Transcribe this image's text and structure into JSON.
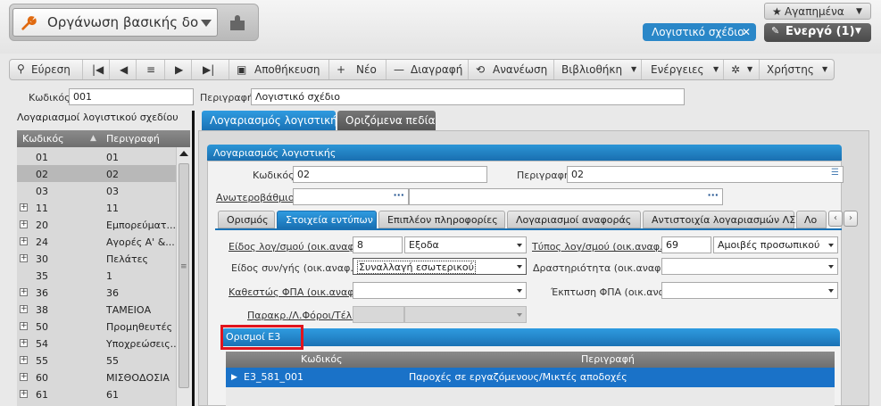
{
  "top": {
    "module_label": "Οργάνωση βασικής δομής",
    "favorites_label": "Αγαπημένα",
    "open_tag_label": "Λογιστικό σχέδιο",
    "active_label": "Ενεργό (1)"
  },
  "toolbar": {
    "search": "Εύρεση",
    "save": "Αποθήκευση",
    "new": "Νέο",
    "delete": "Διαγραφή",
    "refresh": "Ανανέωση",
    "library": "Βιβλιοθήκη",
    "actions": "Ενέργειες",
    "users": "Χρήστης"
  },
  "header": {
    "code_label": "Κωδικός",
    "code_value": "001",
    "desc_label": "Περιγραφή",
    "desc_value": "Λογιστικό σχέδιο"
  },
  "left_list": {
    "title": "Λογαριασμοί λογιστικού σχεδίου",
    "col_code": "Κωδικός",
    "col_desc": "Περιγραφή",
    "rows": [
      {
        "code": "01",
        "desc": "01",
        "expandable": false
      },
      {
        "code": "02",
        "desc": "02",
        "expandable": false
      },
      {
        "code": "03",
        "desc": "03",
        "expandable": false
      },
      {
        "code": "11",
        "desc": "11",
        "expandable": true
      },
      {
        "code": "20",
        "desc": "Εμπορεύματ...",
        "expandable": true
      },
      {
        "code": "24",
        "desc": "Αγορές Α' &...",
        "expandable": true
      },
      {
        "code": "30",
        "desc": "Πελάτες",
        "expandable": true
      },
      {
        "code": "35",
        "desc": "1",
        "expandable": false
      },
      {
        "code": "36",
        "desc": "36",
        "expandable": true
      },
      {
        "code": "38",
        "desc": "ΤΑΜΕΙΟΑ",
        "expandable": true
      },
      {
        "code": "50",
        "desc": "Προμηθευτές",
        "expandable": true
      },
      {
        "code": "54",
        "desc": "Υποχρεώσεις...",
        "expandable": true
      },
      {
        "code": "55",
        "desc": "55",
        "expandable": true
      },
      {
        "code": "60",
        "desc": "ΜΙΣΘΟΔΟΣΙΑ",
        "expandable": true
      },
      {
        "code": "61",
        "desc": "61",
        "expandable": true
      }
    ]
  },
  "main_tabs": [
    "Λογαριασμός λογιστικής",
    "Οριζόμενα πεδία"
  ],
  "account": {
    "section_title": "Λογαριασμός λογιστικής",
    "code_label": "Κωδικός",
    "code_value": "02",
    "desc_label": "Περιγραφή",
    "desc_value": "02",
    "parent_label": "Ανωτεροβάθμιος"
  },
  "inner_tabs": [
    "Ορισμός",
    "Στοιχεία εντύπων",
    "Επιπλέον πληροφορίες",
    "Λογαριασμοί αναφοράς",
    "Αντιστοιχία λογαριασμών ΛΣ",
    "Λο"
  ],
  "form": {
    "account_type_label": "Είδος λογ/σμού (οικ.αναφ.)",
    "account_type_code": "8",
    "account_type_value": "Εξοδα",
    "tx_type_label": "Είδος συν/γής (οικ.αναφ.)",
    "tx_type_value": "Συναλλαγή εσωτερικού",
    "vat_label": "Καθεστώς ΦΠΑ (οικ.αναφ.)",
    "withhold_label": "Παρακρ./Λ.Φόροι/Τέλη",
    "acc_kind_label": "Τύπος λογ/σμού (οικ.αναφ.)",
    "acc_kind_code": "69",
    "acc_kind_value": "Αμοιβές προσωπικού",
    "activity_label": "Δραστηριότητα (οικ.αναφ.)",
    "vat_deduct_label": "Έκπτωση ΦΠΑ (οικ.αναφ.)"
  },
  "e3": {
    "title": "Ορισμοί Ε3",
    "col_code": "Κωδικός",
    "col_desc": "Περιγραφή",
    "rows": [
      {
        "code": "E3_581_001",
        "desc": "Παροχές σε εργαζόμενους/Μικτές αποδοχές"
      }
    ]
  }
}
